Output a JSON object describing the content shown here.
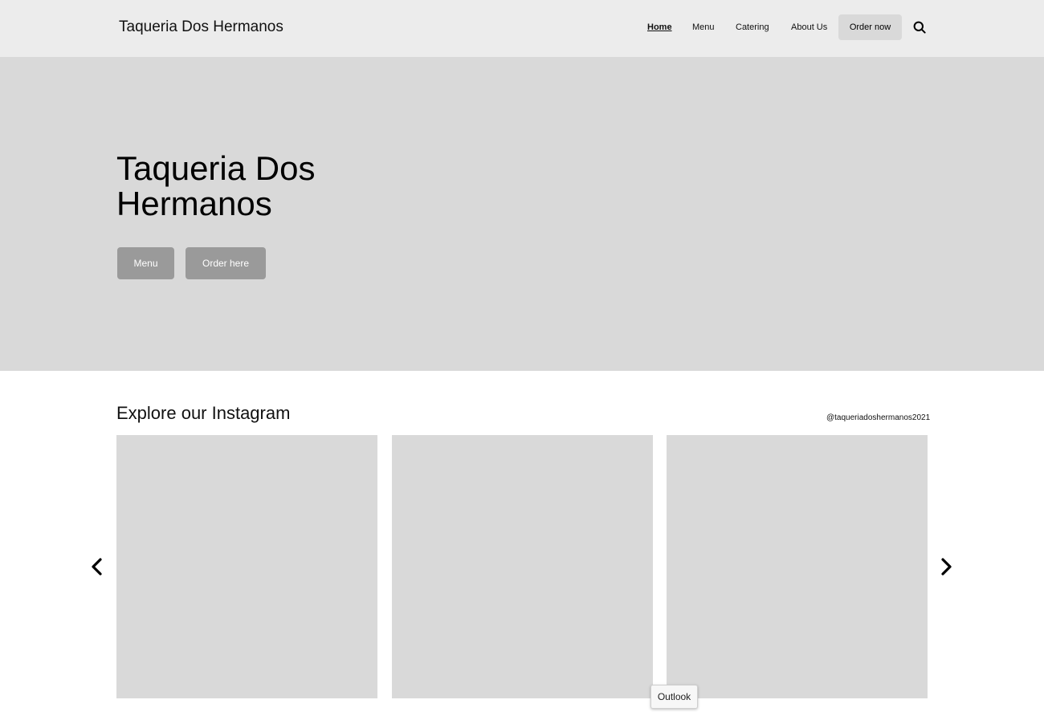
{
  "header": {
    "brand": "Taqueria Dos Hermanos",
    "nav": {
      "home": "Home",
      "menu": "Menu",
      "catering": "Catering",
      "about": "About Us"
    },
    "order_button": "Order now",
    "search_icon": "search-icon"
  },
  "hero": {
    "title": "Taqueria Dos Hermanos",
    "menu_button": "Menu",
    "order_button": "Order here"
  },
  "instagram": {
    "heading": "Explore our Instagram",
    "handle": "@taqueriadoshermanos2021",
    "prev_icon": "chevron-left-icon",
    "next_icon": "chevron-right-icon"
  },
  "tooltip": {
    "label": "Outlook"
  },
  "colors": {
    "header_bg": "#ececec",
    "hero_bg": "#d9d9d9",
    "hero_button_bg": "#9a9a9a",
    "tile_bg": "#d9d9d9"
  }
}
